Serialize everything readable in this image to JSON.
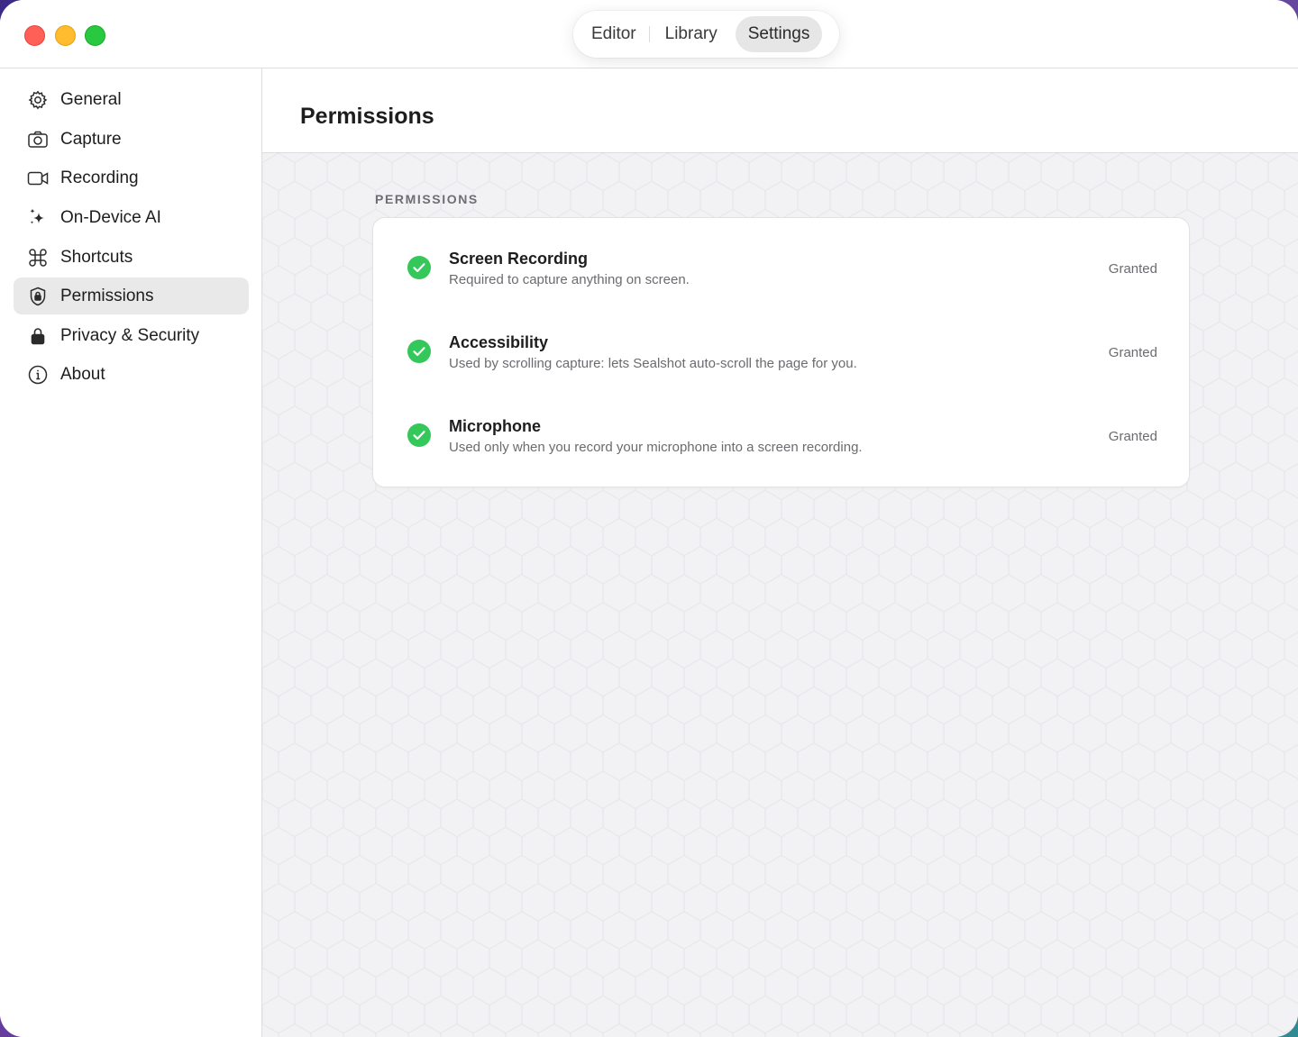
{
  "titlebar": {
    "tabs": [
      {
        "label": "Editor"
      },
      {
        "label": "Library"
      },
      {
        "label": "Settings"
      }
    ],
    "active_tab": "Settings"
  },
  "sidebar": {
    "items": [
      {
        "label": "General",
        "icon": "gear-icon"
      },
      {
        "label": "Capture",
        "icon": "camera-icon"
      },
      {
        "label": "Recording",
        "icon": "video-camera-icon"
      },
      {
        "label": "On-Device AI",
        "icon": "sparkle-icon"
      },
      {
        "label": "Shortcuts",
        "icon": "command-icon"
      },
      {
        "label": "Permissions",
        "icon": "shield-lock-icon"
      },
      {
        "label": "Privacy & Security",
        "icon": "lock-icon"
      },
      {
        "label": "About",
        "icon": "info-icon"
      }
    ],
    "selected": "Permissions"
  },
  "main": {
    "title": "Permissions",
    "section_label": "PERMISSIONS",
    "permissions": [
      {
        "title": "Screen Recording",
        "description": "Required to capture anything on screen.",
        "status": "Granted"
      },
      {
        "title": "Accessibility",
        "description": "Used by scrolling capture: lets Sealshot auto-scroll the page for you.",
        "status": "Granted"
      },
      {
        "title": "Microphone",
        "description": "Used only when you record your microphone into a screen recording.",
        "status": "Granted"
      }
    ]
  },
  "colors": {
    "granted_green": "#34c759",
    "selected_bg": "#e9e9ea",
    "content_bg": "#f2f1f3"
  }
}
